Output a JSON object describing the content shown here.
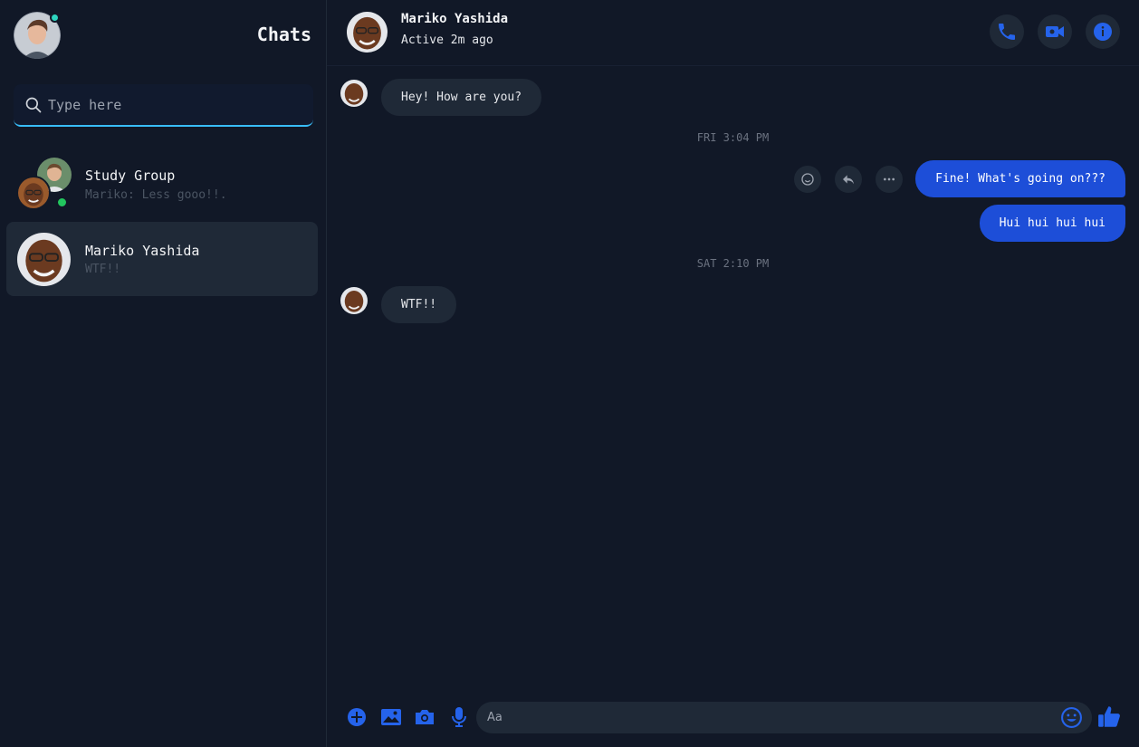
{
  "sidebar": {
    "title": "Chats",
    "search": {
      "placeholder": "Type here",
      "value": ""
    },
    "conversations": [
      {
        "name": "Study Group",
        "preview": "Mariko: Less gooo!!.",
        "online": true,
        "active": false
      },
      {
        "name": "Mariko Yashida",
        "preview": "WTF!!",
        "online": false,
        "active": true
      }
    ]
  },
  "header": {
    "name": "Mariko Yashida",
    "status": "Active 2m ago",
    "actions": [
      "phone-icon",
      "video-icon",
      "info-icon"
    ]
  },
  "messages": [
    {
      "type": "in",
      "text": "Hey! How are you?"
    },
    {
      "type": "time",
      "text": "FRI 3:04 PM"
    },
    {
      "type": "out",
      "text": "Fine! What's going on???"
    },
    {
      "type": "out",
      "text": "Hui hui hui hui"
    },
    {
      "type": "time",
      "text": "SAT 2:10 PM"
    },
    {
      "type": "in",
      "text": "WTF!!"
    }
  ],
  "composer": {
    "placeholder": "Aa",
    "icons": [
      "plus-icon",
      "image-icon",
      "camera-icon",
      "mic-icon",
      "emoji-icon",
      "thumbs-up-icon"
    ]
  },
  "colors": {
    "background": "#111827",
    "accent": "#1d4ed8",
    "icon_blue": "#2563eb",
    "bubble_in": "#1f2937",
    "online_green": "#22c55e",
    "online_teal": "#2dd4bf",
    "search_underline": "#38bdf8"
  }
}
